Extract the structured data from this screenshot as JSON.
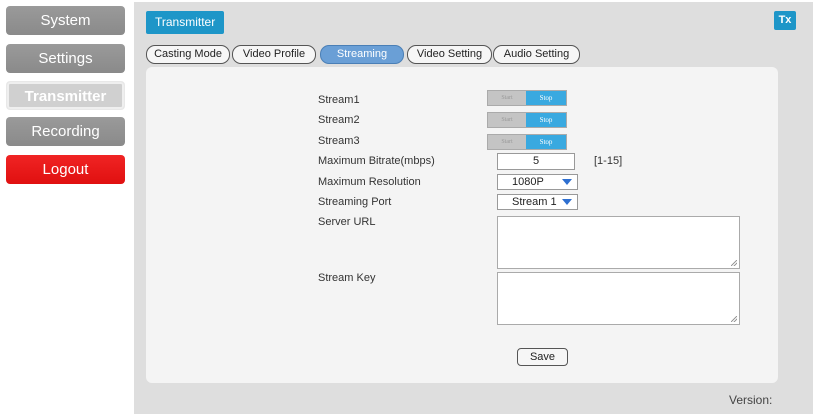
{
  "sidebar": {
    "items": [
      {
        "label": "System"
      },
      {
        "label": "Settings"
      },
      {
        "label": "Transmitter"
      },
      {
        "label": "Recording"
      },
      {
        "label": "Logout"
      }
    ]
  },
  "header": {
    "title": "Transmitter",
    "badge": "Tx"
  },
  "tabs": [
    {
      "label": "Casting Mode"
    },
    {
      "label": "Video Profile"
    },
    {
      "label": "Streaming",
      "active": true
    },
    {
      "label": "Video Setting"
    },
    {
      "label": "Audio Setting"
    }
  ],
  "form": {
    "streams": [
      {
        "label": "Stream1",
        "start": "Start",
        "stop": "Stop"
      },
      {
        "label": "Stream2",
        "start": "Start",
        "stop": "Stop"
      },
      {
        "label": "Stream3",
        "start": "Start",
        "stop": "Stop"
      }
    ],
    "max_bitrate": {
      "label": "Maximum Bitrate(mbps)",
      "value": "5",
      "range": "[1-15]"
    },
    "max_resolution": {
      "label": "Maximum Resolution",
      "value": "1080P"
    },
    "streaming_port": {
      "label": "Streaming Port",
      "value": "Stream 1"
    },
    "server_url": {
      "label": "Server URL",
      "value": ""
    },
    "stream_key": {
      "label": "Stream Key",
      "value": ""
    },
    "save_label": "Save"
  },
  "footer": {
    "version": "Version:"
  },
  "colors": {
    "accent": "#1e96c8",
    "active_tab": "#6a9fd6",
    "logout": "#e01010",
    "stop": "#39a9e0"
  }
}
